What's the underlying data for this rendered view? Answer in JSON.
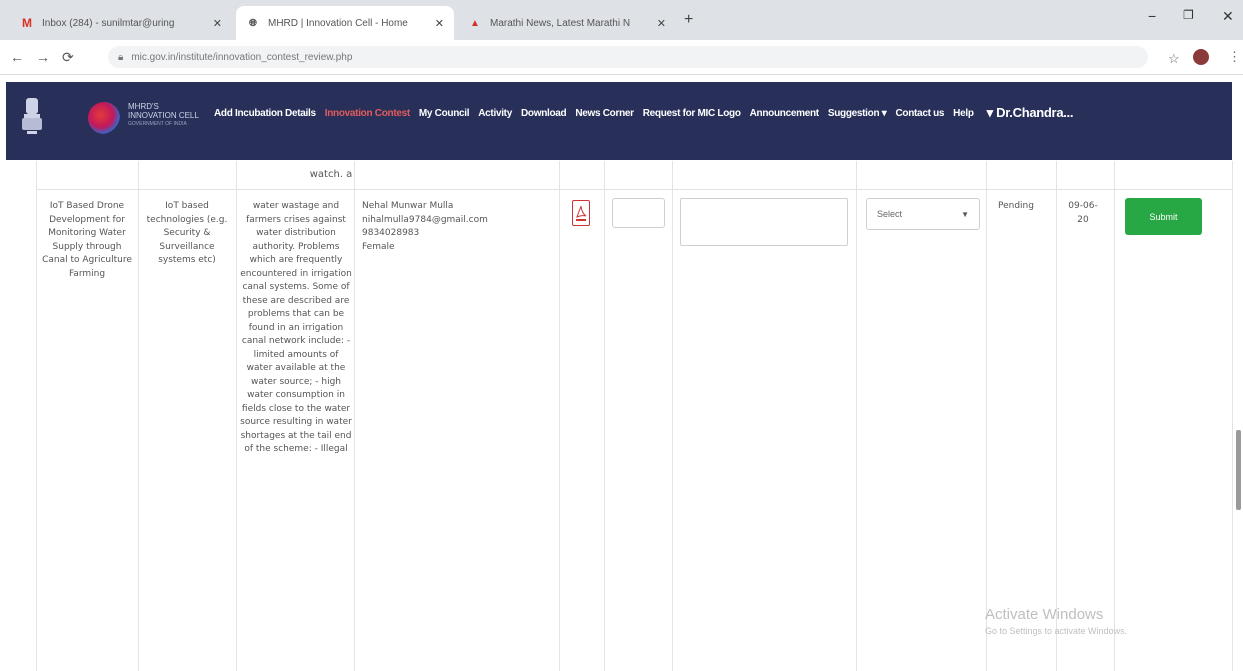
{
  "browser": {
    "tabs": [
      {
        "title": "Inbox (284) - sunilmtar@uring",
        "icon": "gmail-icon",
        "active": false
      },
      {
        "title": "MHRD | Innovation Cell - Home",
        "icon": "globe-icon",
        "active": true
      },
      {
        "title": "Marathi News, Latest Marathi N",
        "icon": "news-icon",
        "active": false
      }
    ],
    "url": "mic.gov.in/institute/innovation_contest_review.php"
  },
  "site": {
    "brand_line1": "MHRD'S",
    "brand_line2": "INNOVATION CELL",
    "brand_line3": "GOVERNMENT OF INDIA",
    "nav": [
      "Add Incubation Details",
      "Innovation Contest",
      "My Council",
      "Activity",
      "Download",
      "News Corner",
      "Request for MIC Logo",
      "Announcement",
      "Suggestion ▾",
      "Contact us",
      "Help"
    ],
    "user": "▾ Dr.Chandra..."
  },
  "table": {
    "prev_row_tail": "watch. a",
    "row": {
      "title": "IoT Based Drone Development for Monitoring Water Supply through Canal to Agriculture Farming",
      "theme": "IoT based technologies (e.g. Security & Surveillance systems etc)",
      "description": "water wastage and farmers crises against water distribution authority. Problems which are frequently encountered in irrigation canal systems. Some of these are described are problems that can be found in an irrigation canal network include: - limited amounts of water available at the water source; - high water consumption in fields close to the water source resulting in water shortages at the tail end of the scheme: - Illegal",
      "student_name": "Nehal Munwar Mulla",
      "student_email": "nihalmulla9784@gmail.com",
      "student_phone": "9834028983",
      "student_gender": "Female",
      "select_value": "Select",
      "status": "Pending",
      "date": "09-06-20",
      "submit_label": "Submit"
    }
  },
  "watermark": {
    "line1": "Activate Windows",
    "line2": "Go to Settings to activate Windows."
  }
}
